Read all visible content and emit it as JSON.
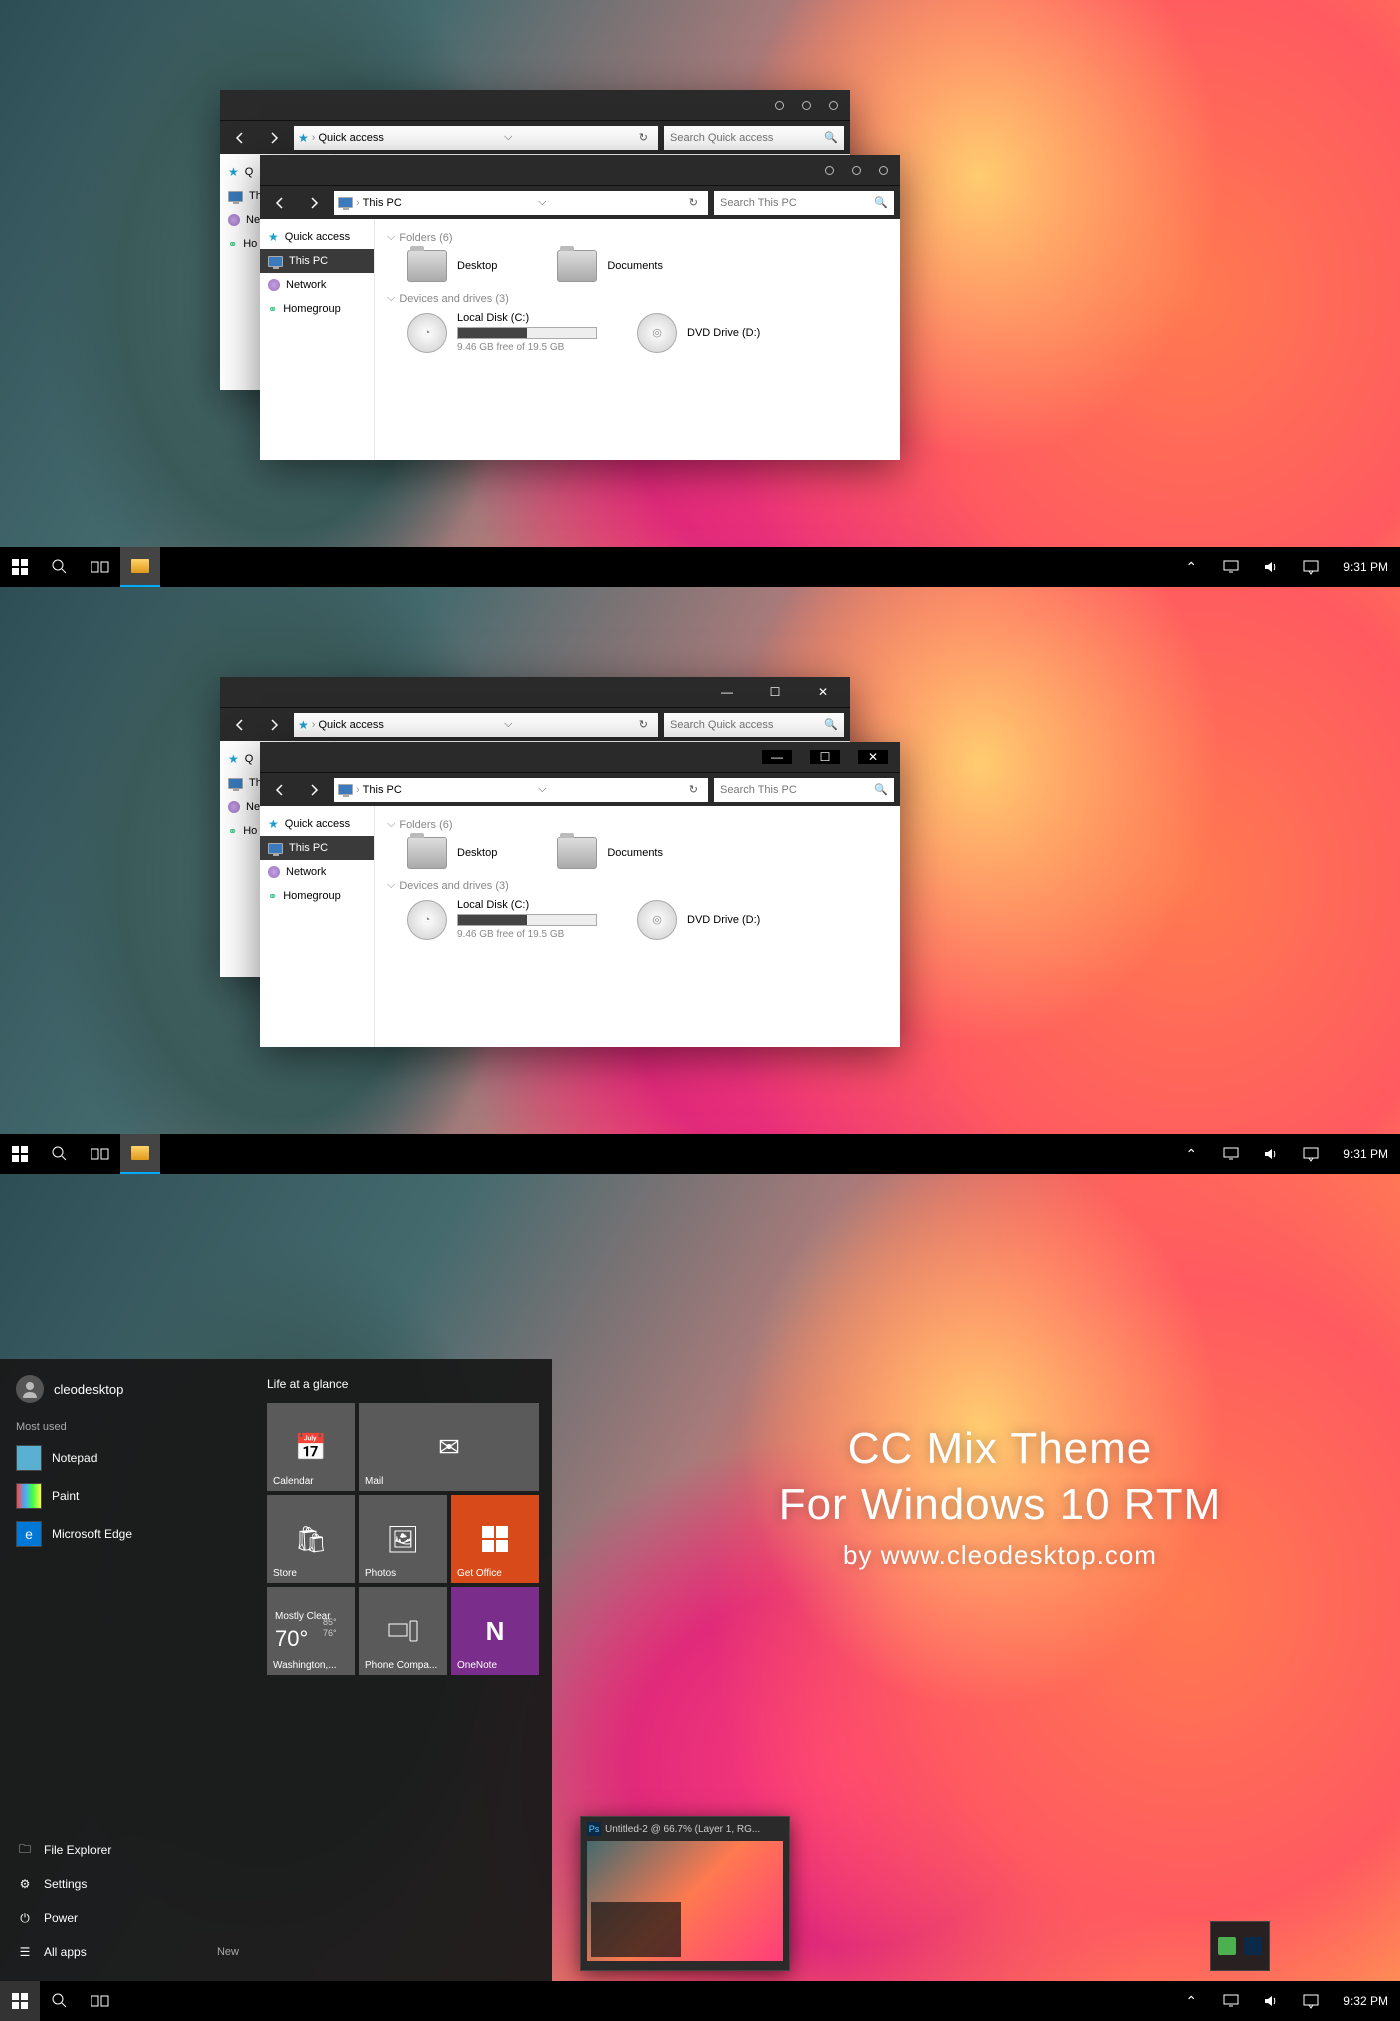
{
  "taskbar": {
    "time1": "9:31 PM",
    "time2": "9:31 PM",
    "time3": "9:32 PM"
  },
  "explorer": {
    "quick_access": "Quick access",
    "this_pc": "This PC",
    "network": "Network",
    "homegroup": "Homegroup",
    "search_quick_placeholder": "Search Quick access",
    "search_pc_placeholder": "Search This PC",
    "folders_hdr": "Folders (6)",
    "devices_hdr": "Devices and drives (3)",
    "desktop": "Desktop",
    "documents": "Documents",
    "local_disk": "Local Disk (C:)",
    "disk_free": "9.46 GB free of 19.5 GB",
    "dvd": "DVD Drive (D:)",
    "bg_qa": "Q",
    "bg_th": "Th",
    "bg_ne": "Ne",
    "bg_ho": "Ho"
  },
  "start": {
    "user": "cleodesktop",
    "most_used": "Most used",
    "app_notepad": "Notepad",
    "app_paint": "Paint",
    "app_edge": "Microsoft Edge",
    "file_explorer": "File Explorer",
    "settings": "Settings",
    "power": "Power",
    "all_apps": "All apps",
    "new": "New",
    "glance": "Life at a glance",
    "tile_calendar": "Calendar",
    "tile_mail": "Mail",
    "tile_store": "Store",
    "tile_photos": "Photos",
    "tile_office": "Get Office",
    "weather_cond": "Mostly Clear",
    "weather_temp": "70°",
    "weather_hi": "85°",
    "weather_lo": "76°",
    "weather_loc": "Washington,...",
    "tile_phone": "Phone Compa...",
    "tile_onenote": "OneNote"
  },
  "promo": {
    "l1": "CC Mix Theme",
    "l2": "For Windows 10 RTM",
    "l3": "by www.cleodesktop.com"
  },
  "thumb": {
    "title": "Untitled-2 @ 66.7% (Layer 1, RG..."
  }
}
